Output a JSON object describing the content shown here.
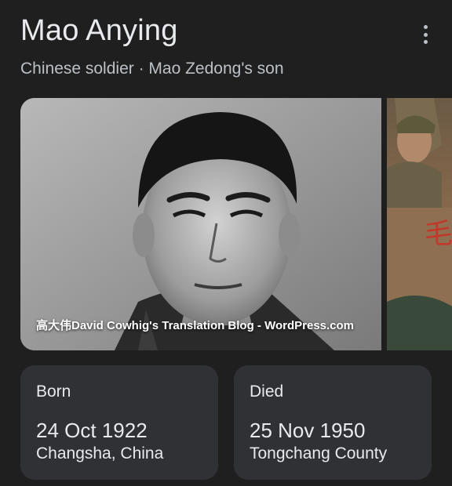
{
  "header": {
    "title": "Mao Anying",
    "subtitle": "Chinese soldier · Mao Zedong's son",
    "more_icon": "more-vertical-icon"
  },
  "images": {
    "main_photo_credit": "高大伟David Cowhig's Translation Blog - WordPress.com",
    "second_photo_text": "毛"
  },
  "facts": {
    "born": {
      "label": "Born",
      "date": "24 Oct 1922",
      "place": "Changsha, China"
    },
    "died": {
      "label": "Died",
      "date": "25 Nov 1950",
      "place": "Tongchang County"
    }
  },
  "colors": {
    "background": "#1f1f1f",
    "card": "#303134",
    "text_primary": "#e8eaed",
    "text_secondary": "#bdc1c6"
  }
}
